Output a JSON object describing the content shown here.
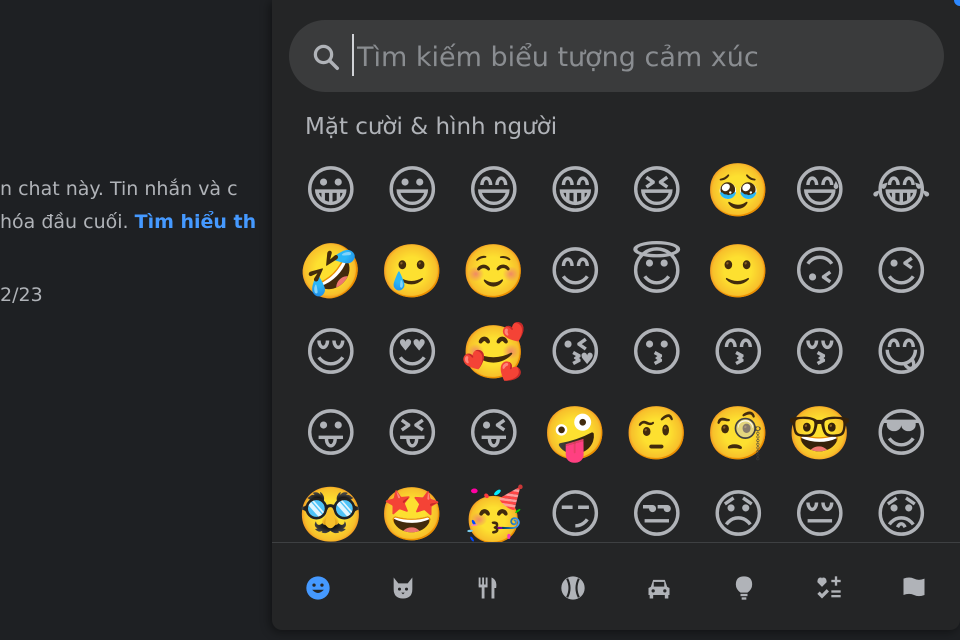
{
  "chat": {
    "line1": "n chat này. Tin nhắn và c",
    "line2_text": " hóa đầu cuối. ",
    "line2_link": "Tìm hiểu th",
    "line3": "2/23"
  },
  "picker": {
    "search": {
      "placeholder": "Tìm kiếm biểu tượng cảm xúc",
      "value": ""
    },
    "section_title": "Mặt cười & hình người",
    "emojis": [
      "😀",
      "😃",
      "😄",
      "😁",
      "😆",
      "🥹",
      "😅",
      "😂",
      "🤣",
      "🥲",
      "☺️",
      "😊",
      "😇",
      "🙂",
      "🙃",
      "😉",
      "😌",
      "😍",
      "🥰",
      "😘",
      "😗",
      "😙",
      "😚",
      "😋",
      "😛",
      "😝",
      "😜",
      "🤪",
      "🤨",
      "🧐",
      "🤓",
      "😎",
      "🥸",
      "🤩",
      "🥳",
      "😏",
      "😒",
      "😞",
      "😔",
      "😟"
    ],
    "tabs": [
      {
        "icon": "smiley-icon",
        "label": "Mặt cười & hình người",
        "active": true
      },
      {
        "icon": "animal-icon",
        "label": "Động vật"
      },
      {
        "icon": "food-icon",
        "label": "Đồ ăn"
      },
      {
        "icon": "ball-icon",
        "label": "Hoạt động"
      },
      {
        "icon": "car-icon",
        "label": "Du lịch"
      },
      {
        "icon": "lightbulb-icon",
        "label": "Đồ vật"
      },
      {
        "icon": "symbols-icon",
        "label": "Biểu tượng"
      },
      {
        "icon": "flag-icon",
        "label": "Cờ"
      }
    ],
    "colors": {
      "active": "#4599ff",
      "inactive": "#b0b3b8",
      "panel": "#242526",
      "search_bg": "#3a3b3c"
    }
  }
}
